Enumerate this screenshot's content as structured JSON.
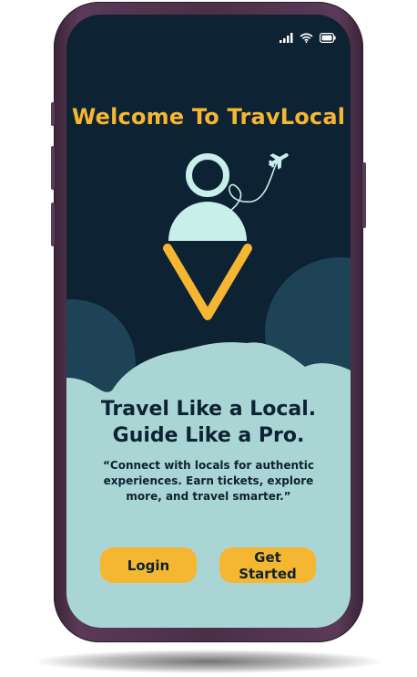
{
  "colors": {
    "background": "#0d2233",
    "accent": "#f5b731",
    "mint": "#a9d6d4",
    "hill": "#1e4256",
    "logo_head": "#c9efea",
    "frame": "#4b2f49"
  },
  "status_bar": {
    "icons": [
      "signal-icon",
      "wifi-icon",
      "battery-icon"
    ]
  },
  "welcome_title": "Welcome To TravLocal",
  "logo": {
    "icons": [
      "person-pin-icon",
      "airplane-icon"
    ]
  },
  "hero": {
    "headline_line1": "Travel Like a Local.",
    "headline_line2": "Guide Like a Pro.",
    "tagline_line1": "“Connect with locals for authentic",
    "tagline_line2": "experiences. Earn tickets, explore",
    "tagline_line3": "more, and travel smarter.”"
  },
  "buttons": {
    "login_label": "Login",
    "get_started_label": "Get Started"
  }
}
